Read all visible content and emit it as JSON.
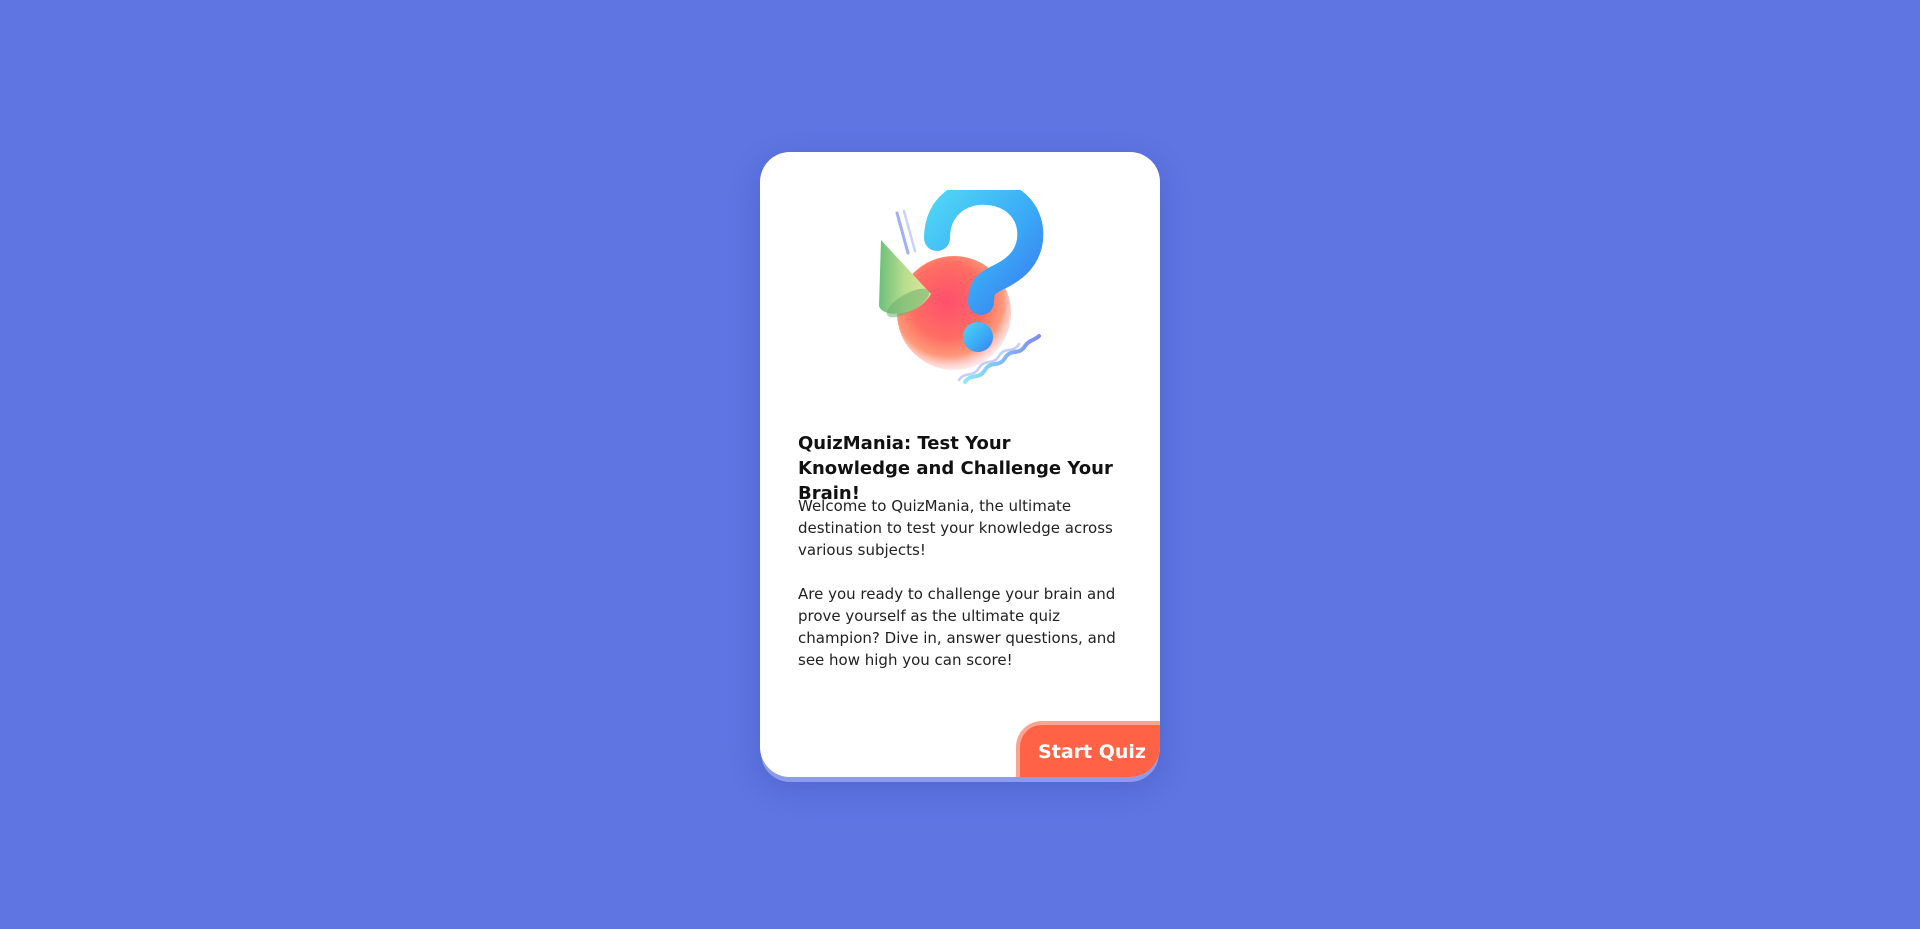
{
  "page": {
    "background_color": "#5e75e2"
  },
  "card": {
    "illustration": "question-mark-illustration",
    "title": "QuizMania: Test Your Knowledge and Challenge Your Brain!",
    "paragraphs": [
      "Welcome to QuizMania, the ultimate destination to test your knowledge across various subjects!",
      "Are you ready to challenge your brain and prove yourself as the ultimate quiz champion? Dive in, answer questions, and see how high you can score!"
    ],
    "start_button_label": "Start Quiz",
    "accent_color": "#ff6244"
  }
}
